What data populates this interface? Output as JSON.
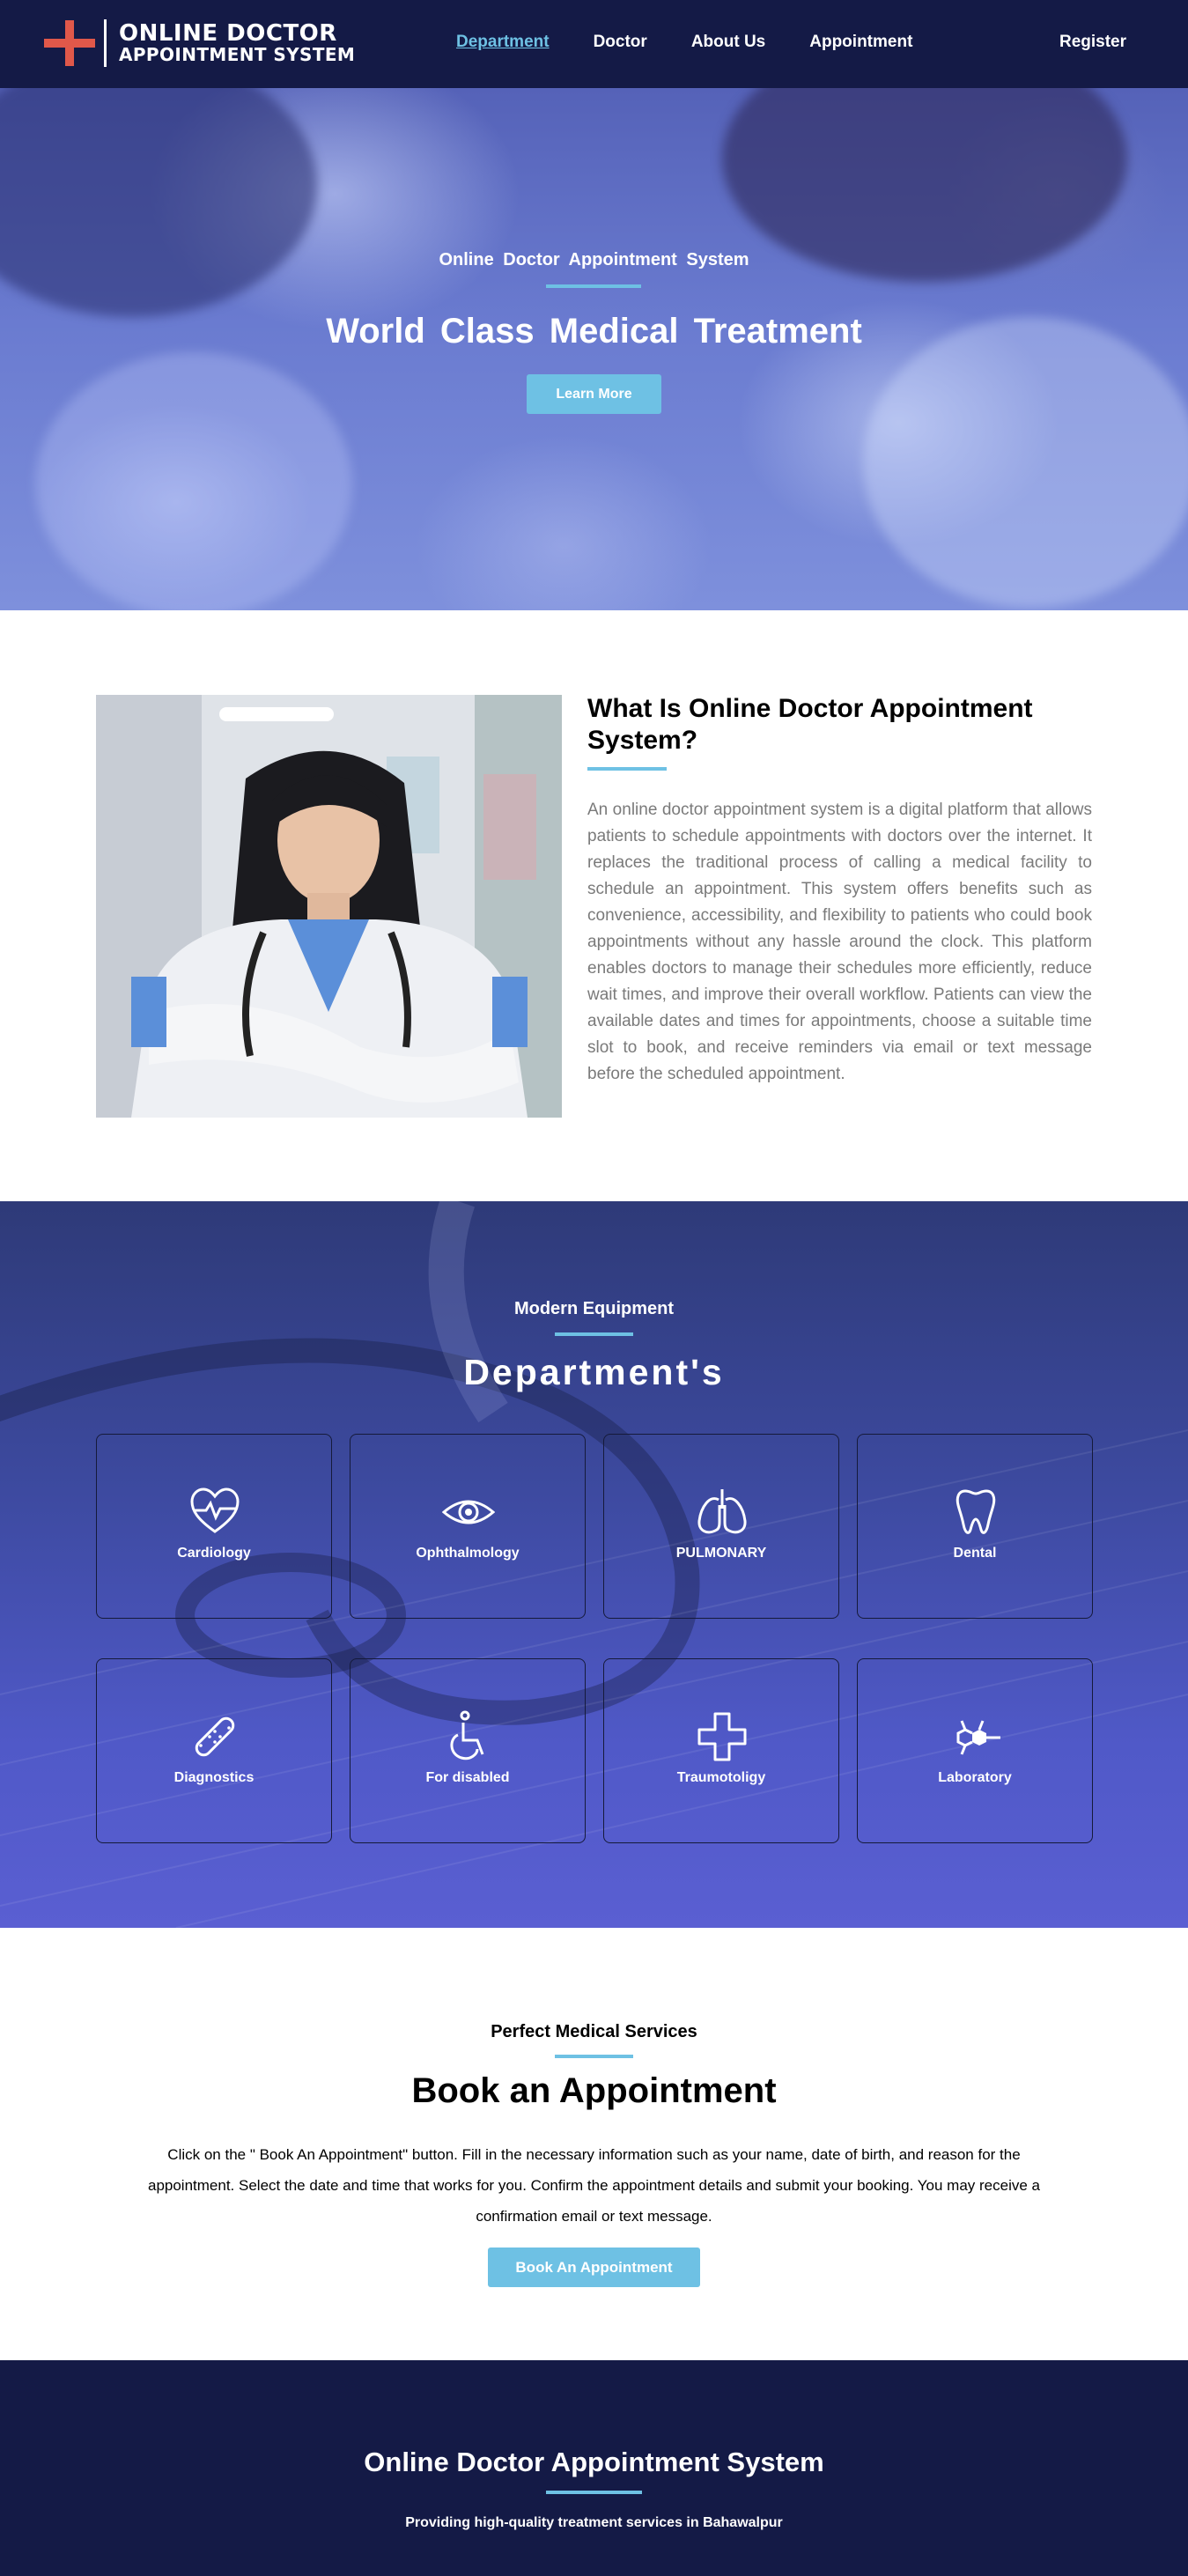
{
  "nav": {
    "logo_line1": "ONLINE DOCTOR",
    "logo_line2": "APPOINTMENT SYSTEM",
    "links": [
      "Department",
      "Doctor",
      "About Us",
      "Appointment"
    ],
    "active": "Department",
    "register": "Register"
  },
  "hero": {
    "kicker": "Online Doctor Appointment System",
    "title": "World Class Medical Treatment",
    "button": "Learn More"
  },
  "about": {
    "title": "What Is Online Doctor Appointment System?",
    "text": "An online doctor appointment system is a digital platform that allows patients to schedule appointments with doctors over the internet. It replaces the traditional process of calling a medical facility to schedule an appointment. This system offers benefits such as convenience, accessibility, and flexibility to patients who could book appointments without any hassle around the clock. This platform enables doctors to manage their schedules more efficiently, reduce wait times, and improve their overall workflow. Patients can view the available dates and times for appointments, choose a suitable time slot to book, and receive reminders via email or text message before the scheduled appointment."
  },
  "departments": {
    "kicker": "Modern Equipment",
    "title": "Department's",
    "items": [
      {
        "label": "Cardiology",
        "icon": "heart-pulse-icon"
      },
      {
        "label": "Ophthalmology",
        "icon": "eye-icon"
      },
      {
        "label": "PULMONARY",
        "icon": "lungs-icon"
      },
      {
        "label": "Dental",
        "icon": "tooth-icon"
      },
      {
        "label": "Diagnostics",
        "icon": "bandage-icon"
      },
      {
        "label": "For disabled",
        "icon": "wheelchair-icon"
      },
      {
        "label": "Traumotoligy",
        "icon": "medical-cross-icon"
      },
      {
        "label": "Laboratory",
        "icon": "molecule-icon"
      }
    ]
  },
  "book": {
    "kicker": "Perfect Medical Services",
    "title": "Book an Appointment",
    "text": "Click on the \" Book An Appointment\" button. Fill in the necessary information such as your name, date of birth, and reason for the appointment. Select the date and time that works for you. Confirm the appointment details and submit your booking. You may receive a confirmation email or text message.",
    "button": "Book An Appointment"
  },
  "footer": {
    "title": "Online Doctor Appointment System",
    "subtitle": "Providing high-quality treatment services in Bahawalpur"
  },
  "colors": {
    "nav_bg": "#141a46",
    "accent": "#6ec1e4",
    "logo_red": "#e0584a"
  }
}
